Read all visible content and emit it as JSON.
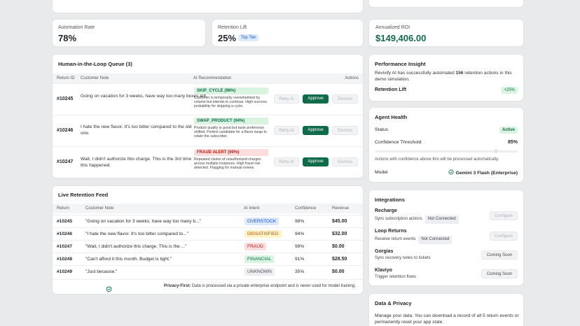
{
  "metrics": {
    "automation": {
      "label": "Automation Rate",
      "value": "78%"
    },
    "retention": {
      "label": "Retention Lift",
      "value": "25%",
      "badge": "Top Tier"
    },
    "roi": {
      "label": "Annualized ROI",
      "value": "$149,406.00"
    }
  },
  "queue": {
    "title": "Human-in-the-Loop Queue (3)",
    "headers": {
      "id": "Return ID",
      "note": "Customer Note",
      "rec": "AI Recommendation",
      "actions": "Actions"
    },
    "buttons": {
      "retry": "Retry AI",
      "approve": "Approve",
      "dismiss": "Dismiss"
    },
    "rows": [
      {
        "id": "#10245",
        "note": "Going on vacation for 3 weeks, have way too many boxes left.",
        "tag": "SKIP_CYCLE (98%)",
        "desc": "Customer is temporarily overwhelmed by volume but intends to continue. High success probability for skipping a cycle."
      },
      {
        "id": "#10246",
        "note": "I hate the new flavor. It's too bitter compared to the old one.",
        "tag": "SWAP_PRODUCT (94%)",
        "desc": "Product quality is good but taste preference shifted. Perfect candidate for a flavor swap to retain the subscriber."
      },
      {
        "id": "#10247",
        "note": "Wait, I didn't authorize this charge. This is the 3rd time this happened.",
        "tag": "FRAUD ALERT (99%)",
        "desc": "Repeated claims of unauthorized charges across multiple instances. High fraud risk detected. Flagging for manual review."
      }
    ]
  },
  "feed": {
    "title": "Live Retention Feed",
    "headers": {
      "ret": "Return",
      "note": "Customer Note",
      "intent": "AI Intent",
      "conf": "Confidence",
      "rev": "Revenue"
    },
    "rows": [
      {
        "id": "#10245",
        "note": "\"Going on vacation for 3 weeks, have way too many b...\"",
        "intent": "OVERSTOCK",
        "conf": "98%",
        "rev": "$45.00"
      },
      {
        "id": "#10246",
        "note": "\"I hate the new flavor. It's too bitter compared to...\"",
        "intent": "DISSATISFIED",
        "conf": "94%",
        "rev": "$32.00"
      },
      {
        "id": "#10247",
        "note": "\"Wait, I didn't authorize this charge. This is the ...\"",
        "intent": "FRAUD",
        "conf": "99%",
        "rev": "$0.00"
      },
      {
        "id": "#10248",
        "note": "\"Can't afford it this month. Budget is tight.\"",
        "intent": "FINANCIAL",
        "conf": "91%",
        "rev": "$28.50"
      },
      {
        "id": "#10249",
        "note": "\"Just because.\"",
        "intent": "UNKNOWN",
        "conf": "35%",
        "rev": "$0.00"
      }
    ],
    "privacy_bold": "Privacy-First:",
    "privacy_text": " Data is processed via a private enterprise endpoint and is never used for model training."
  },
  "insight": {
    "title": "Performance Insight",
    "text_a": "Revivify AI has successfully automated ",
    "count": "156",
    "text_b": " retention actions in this demo simulation.",
    "lift_label": "Retention Lift",
    "lift_value": "+25%"
  },
  "health": {
    "title": "Agent Health",
    "status_label": "Status",
    "status_value": "Active",
    "threshold_label": "Confidence Threshold",
    "threshold_value": "85%",
    "threshold_level": 0.85,
    "help": "Actions with confidence above this will be processed automatically.",
    "model_label": "Model",
    "model_value": "Gemini 3 Flash (Enterprise)"
  },
  "integrations": {
    "title": "Integrations",
    "items": [
      {
        "name": "Recharge",
        "desc": "Sync subscription actions",
        "status": "Not Connected",
        "action": "Configure"
      },
      {
        "name": "Loop Returns",
        "desc": "Receive return events",
        "status": "Not Connected",
        "action": "Configure"
      },
      {
        "name": "Gorgias",
        "desc": "Sync recovery notes to tickets",
        "status": "",
        "action": "Coming Soon"
      },
      {
        "name": "Klaviyo",
        "desc": "Trigger retention flows",
        "status": "",
        "action": "Coming Soon"
      }
    ]
  },
  "privacy_card": {
    "title": "Data & Privacy",
    "text": "Manage your data. You can download a record of all 5 return events or permanently reset your app state."
  },
  "colors": {
    "accent": "#0f6b4a"
  }
}
